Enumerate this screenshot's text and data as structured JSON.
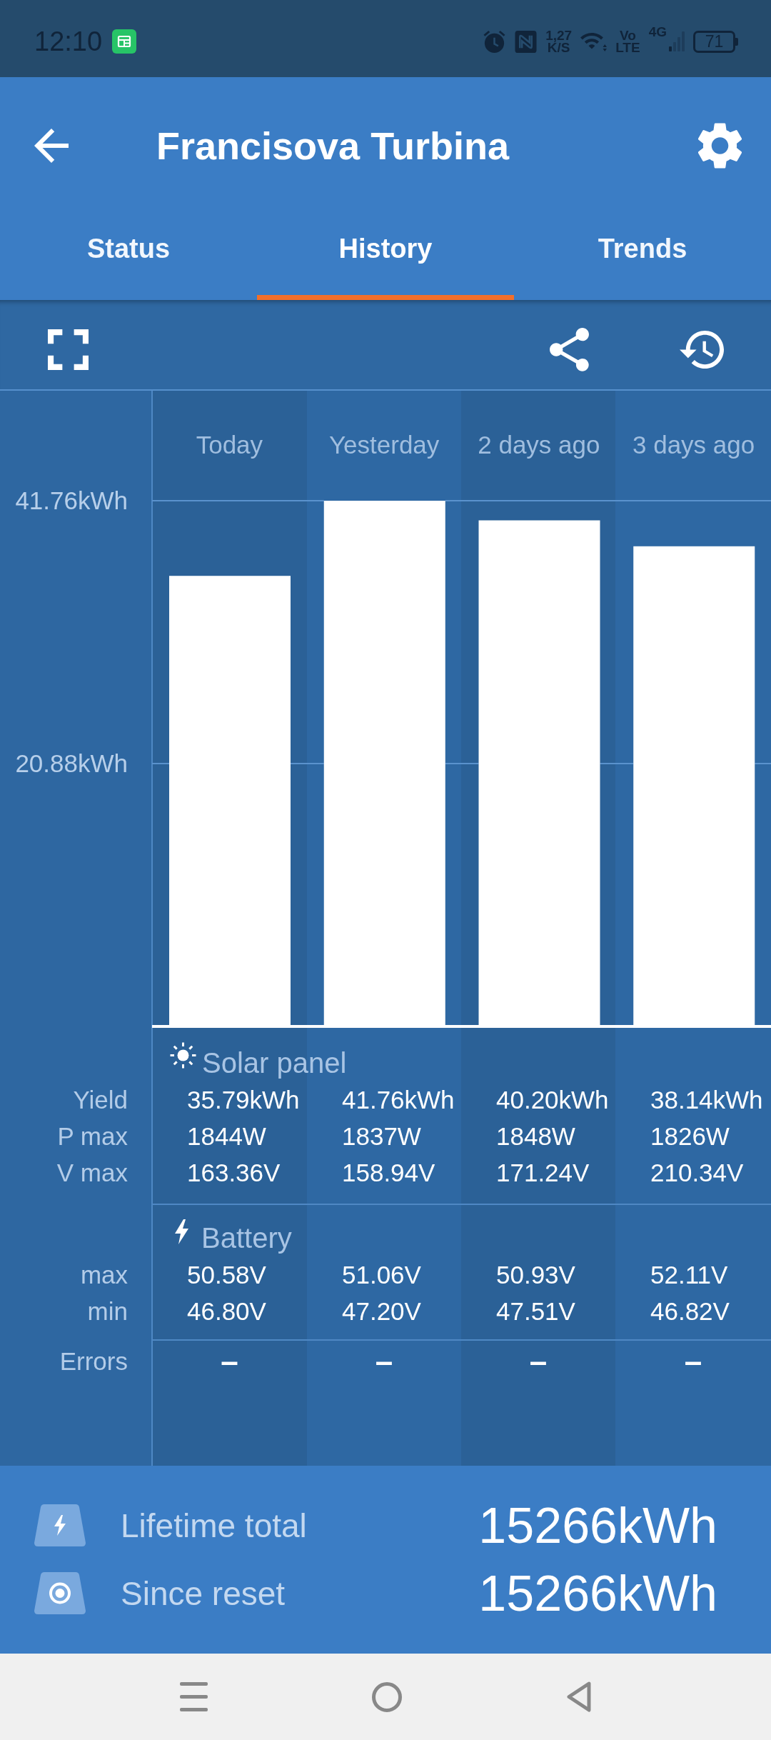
{
  "status_bar": {
    "time": "12:10",
    "network_speed": [
      "1,27",
      "K/S"
    ],
    "volte": [
      "Vo",
      "LTE"
    ],
    "network_type": "4G",
    "battery": "71"
  },
  "app_bar": {
    "title": "Francisova Turbina"
  },
  "tabs": [
    {
      "label": "Status",
      "selected": false
    },
    {
      "label": "History",
      "selected": true
    },
    {
      "label": "Trends",
      "selected": false
    }
  ],
  "history": {
    "chart_data": {
      "type": "bar",
      "categories": [
        "Today",
        "Yesterday",
        "2 days ago",
        "3 days ago"
      ],
      "values": [
        35.79,
        41.76,
        40.2,
        38.14
      ],
      "ylim": [
        0,
        41.76
      ],
      "yticks": [
        {
          "value": 20.88,
          "label": "20.88kWh"
        },
        {
          "value": 41.76,
          "label": "41.76kWh"
        }
      ]
    },
    "sections": [
      {
        "kind": "solar",
        "title": "Solar panel",
        "rows": [
          {
            "label": "Yield",
            "values": [
              "35.79kWh",
              "41.76kWh",
              "40.20kWh",
              "38.14kWh"
            ]
          },
          {
            "label": "P max",
            "values": [
              "1844W",
              "1837W",
              "1848W",
              "1826W"
            ]
          },
          {
            "label": "V max",
            "values": [
              "163.36V",
              "158.94V",
              "171.24V",
              "210.34V"
            ]
          }
        ]
      },
      {
        "kind": "battery",
        "title": "Battery",
        "rows": [
          {
            "label": "max",
            "values": [
              "50.58V",
              "51.06V",
              "50.93V",
              "52.11V"
            ]
          },
          {
            "label": "min",
            "values": [
              "46.80V",
              "47.20V",
              "47.51V",
              "46.82V"
            ]
          }
        ]
      },
      {
        "kind": "errors",
        "rows": [
          {
            "label": "Errors",
            "values": [
              "–",
              "–",
              "–",
              "–"
            ]
          }
        ]
      }
    ]
  },
  "totals": [
    {
      "kind": "lifetime",
      "label": "Lifetime total",
      "value": "15266kWh"
    },
    {
      "kind": "reset",
      "label": "Since reset",
      "value": "15266kWh"
    }
  ]
}
